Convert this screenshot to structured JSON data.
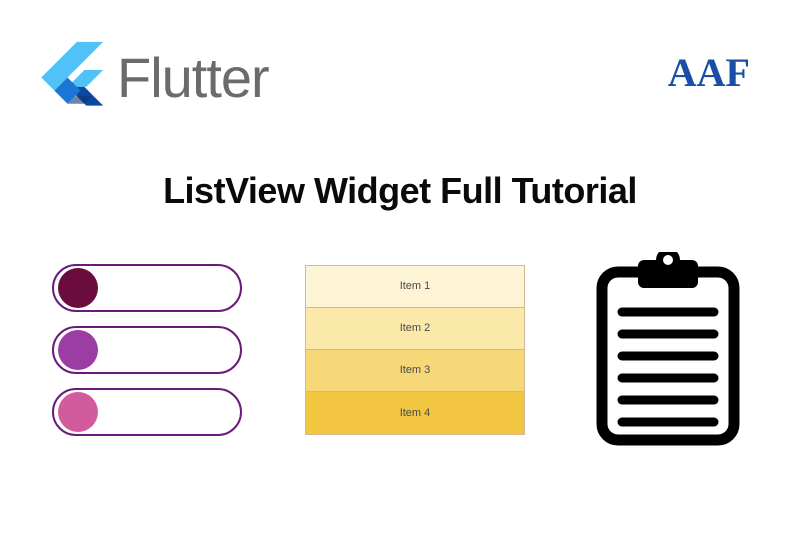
{
  "header": {
    "flutter_label": "Flutter",
    "aaf_label": "AAF"
  },
  "title": "ListView Widget Full Tutorial",
  "colors": {
    "pill_border": "#6a1b7a",
    "dot1": "#6a0d3e",
    "dot2": "#9c3da3",
    "dot3": "#d15b9c",
    "row1": "#fdf4d5",
    "row2": "#fbe9a9",
    "row3": "#f7d878",
    "row4": "#f3c642"
  },
  "items": [
    {
      "label": "Item 1"
    },
    {
      "label": "Item 2"
    },
    {
      "label": "Item 3"
    },
    {
      "label": "Item 4"
    }
  ]
}
